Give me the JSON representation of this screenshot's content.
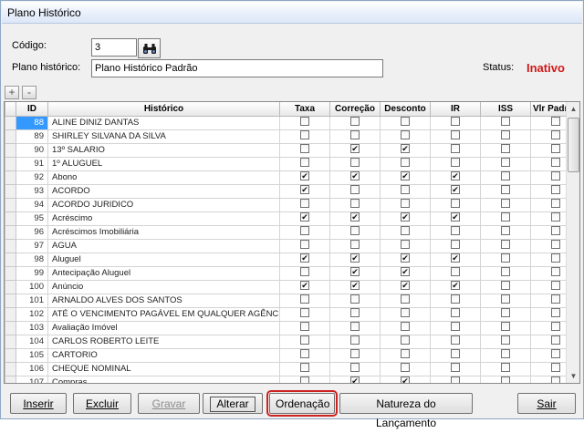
{
  "window": {
    "title": "Plano Histórico"
  },
  "form": {
    "codigo_label": "Código:",
    "codigo_value": "3",
    "plano_label": "Plano histórico:",
    "plano_value": "Plano Histórico Padrão",
    "status_label": "Status:",
    "status_value": "Inativo",
    "status_color": "#d21919"
  },
  "grid_tools": {
    "add": "+",
    "remove": "-"
  },
  "grid": {
    "columns": [
      "ID",
      "Histórico",
      "Taxa",
      "Correção",
      "Desconto",
      "IR",
      "ISS",
      "Vlr Padrão"
    ],
    "rows": [
      {
        "id": "88",
        "historico": "ALINE DINIZ DANTAS",
        "checks": [
          false,
          false,
          false,
          false,
          false,
          false
        ],
        "selected": true
      },
      {
        "id": "89",
        "historico": "SHIRLEY SILVANA DA SILVA",
        "checks": [
          false,
          false,
          false,
          false,
          false,
          false
        ]
      },
      {
        "id": "90",
        "historico": "13º SALARIO",
        "checks": [
          false,
          true,
          true,
          false,
          false,
          false
        ]
      },
      {
        "id": "91",
        "historico": "1º ALUGUEL",
        "checks": [
          false,
          false,
          false,
          false,
          false,
          false
        ]
      },
      {
        "id": "92",
        "historico": "Abono",
        "checks": [
          true,
          true,
          true,
          true,
          false,
          false
        ]
      },
      {
        "id": "93",
        "historico": "ACORDO",
        "checks": [
          true,
          false,
          false,
          true,
          false,
          false
        ]
      },
      {
        "id": "94",
        "historico": "ACORDO JURIDICO",
        "checks": [
          false,
          false,
          false,
          false,
          false,
          false
        ]
      },
      {
        "id": "95",
        "historico": "Acréscimo",
        "checks": [
          true,
          true,
          true,
          true,
          false,
          false
        ]
      },
      {
        "id": "96",
        "historico": "Acréscimos Imobiliária",
        "checks": [
          false,
          false,
          false,
          false,
          false,
          false
        ]
      },
      {
        "id": "97",
        "historico": "AGUA",
        "checks": [
          false,
          false,
          false,
          false,
          false,
          false
        ]
      },
      {
        "id": "98",
        "historico": "Aluguel",
        "checks": [
          true,
          true,
          true,
          true,
          false,
          false
        ]
      },
      {
        "id": "99",
        "historico": "Antecipação Aluguel",
        "checks": [
          false,
          true,
          true,
          false,
          false,
          false
        ]
      },
      {
        "id": "100",
        "historico": "Anúncio",
        "checks": [
          true,
          true,
          true,
          true,
          false,
          false
        ]
      },
      {
        "id": "101",
        "historico": "ARNALDO ALVES DOS SANTOS",
        "checks": [
          false,
          false,
          false,
          false,
          false,
          false
        ]
      },
      {
        "id": "102",
        "historico": "ATÉ O VENCIMENTO PAGÁVEL EM QUALQUER AGÊNCIA",
        "checks": [
          false,
          false,
          false,
          false,
          false,
          false
        ]
      },
      {
        "id": "103",
        "historico": "Avaliação Imóvel",
        "checks": [
          false,
          false,
          false,
          false,
          false,
          false
        ]
      },
      {
        "id": "104",
        "historico": "CARLOS ROBERTO LEITE",
        "checks": [
          false,
          false,
          false,
          false,
          false,
          false
        ]
      },
      {
        "id": "105",
        "historico": "CARTORIO",
        "checks": [
          false,
          false,
          false,
          false,
          false,
          false
        ]
      },
      {
        "id": "106",
        "historico": "CHEQUE NOMINAL",
        "checks": [
          false,
          false,
          false,
          false,
          false,
          false
        ]
      },
      {
        "id": "107",
        "historico": "Compras",
        "checks": [
          false,
          true,
          true,
          false,
          false,
          false
        ]
      }
    ]
  },
  "buttons": {
    "inserir": "Inserir",
    "excluir": "Excluir",
    "gravar": "Gravar",
    "alterar": "Alterar",
    "ordenacao": "Ordenação",
    "natureza": "Natureza do Lançamento",
    "sair": "Sair"
  },
  "icons": {
    "search": "binoculars-icon",
    "check": "✔"
  }
}
